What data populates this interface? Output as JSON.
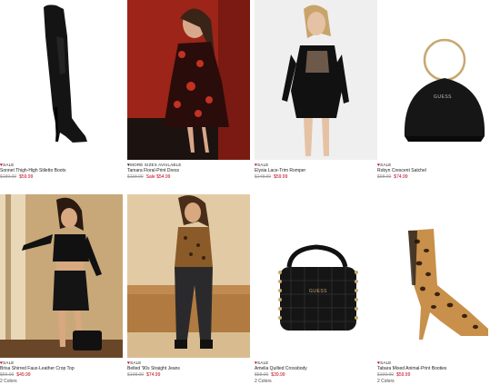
{
  "products": [
    {
      "badge": "SALE",
      "name": "Sonnet Thigh-High Stiletto Boots",
      "original_price": "$189.00",
      "sale_price": "$59.99",
      "colors": ""
    },
    {
      "badge": "MORE SIZES AVAILABLE",
      "name": "Tamara Floral-Print Dress",
      "original_price": "$118.00",
      "sale_price": "Sale $54.99",
      "colors": ""
    },
    {
      "badge": "SALE",
      "name": "Elysia Lace-Trim Romper",
      "original_price": "$148.00",
      "sale_price": "$59.99",
      "colors": ""
    },
    {
      "badge": "SALE",
      "name": "Robyn Crescent Satchel",
      "original_price": "$98.00",
      "sale_price": "$74.99",
      "colors": ""
    },
    {
      "badge": "SALE",
      "name": "Brisa Shirred Faux-Leather Crop Top",
      "original_price": "$69.00",
      "sale_price": "$49.99",
      "colors": "2 Colors"
    },
    {
      "badge": "SALE",
      "name": "Belted '90s Straight Jeans",
      "original_price": "$108.00",
      "sale_price": "$74.99",
      "colors": ""
    },
    {
      "badge": "SALE",
      "name": "Amelia Quilted Crossbody",
      "original_price": "$58.00",
      "sale_price": "$39.99",
      "colors": "2 Colors"
    },
    {
      "badge": "SALE",
      "name": "Tabara Mixed Animal-Print Booties",
      "original_price": "$109.00",
      "sale_price": "$59.99",
      "colors": "2 Colors"
    }
  ],
  "logo_text": "GUESS",
  "colors": {
    "sale_red": "#c0001a",
    "strike_gray": "#9a9a9a"
  }
}
